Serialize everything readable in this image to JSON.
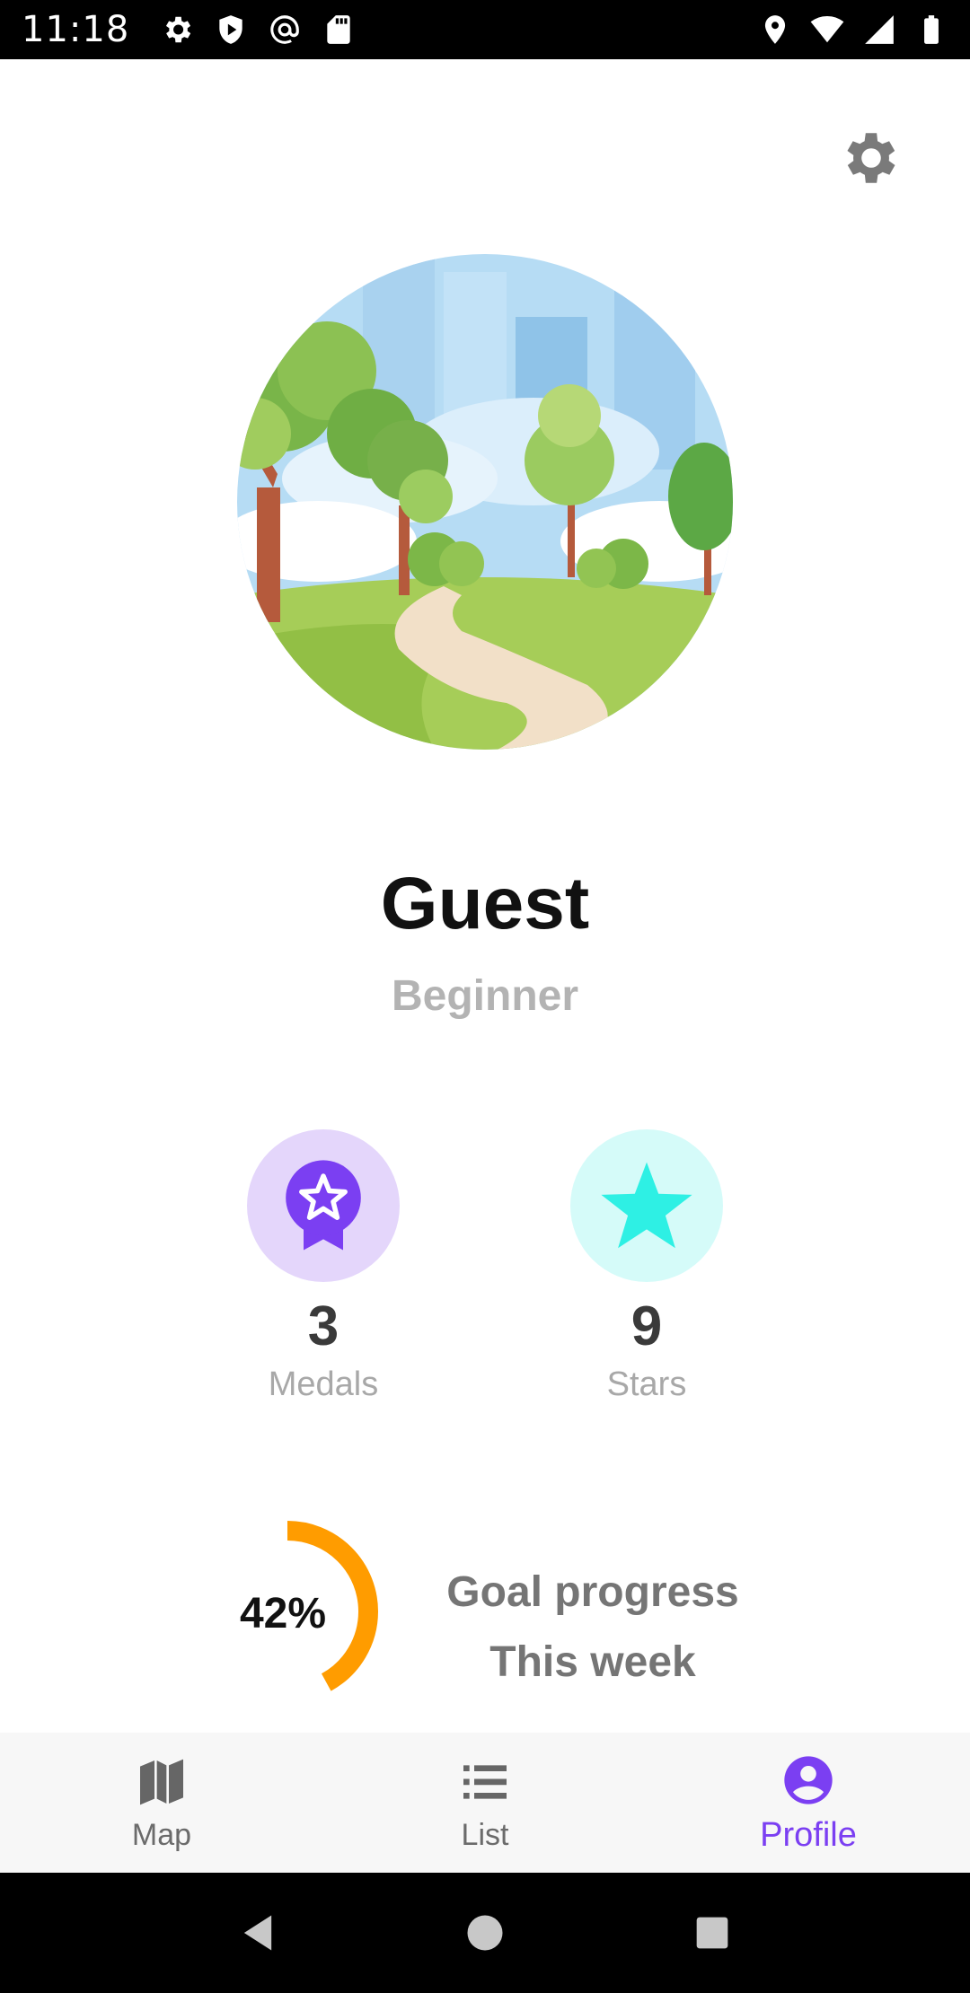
{
  "status_bar": {
    "time": "11:18",
    "left_icons": [
      "gear-icon",
      "shield-icon",
      "at-icon",
      "sd-card-icon"
    ],
    "right_icons": [
      "location-icon",
      "wifi-icon",
      "signal-icon",
      "battery-icon"
    ]
  },
  "settings": {
    "icon": "gear-icon"
  },
  "profile": {
    "name": "Guest",
    "level": "Beginner"
  },
  "stats": {
    "medals": {
      "value": "3",
      "label": "Medals",
      "icon": "medal-icon",
      "color": "#7b3ff2",
      "bg": "#e4d6fb"
    },
    "stars": {
      "value": "9",
      "label": "Stars",
      "icon": "star-icon",
      "color": "#2ef0e4",
      "bg": "#d5fbf9"
    }
  },
  "goal": {
    "percent_label": "42%",
    "fraction": 0.42,
    "title": "Goal progress",
    "subtitle": "This week",
    "color": "#ff9c00"
  },
  "bottom_nav": {
    "items": [
      {
        "label": "Map",
        "icon": "map-icon"
      },
      {
        "label": "List",
        "icon": "list-icon"
      },
      {
        "label": "Profile",
        "icon": "profile-icon",
        "active": true
      }
    ],
    "active_color": "#7b3ff2"
  },
  "system_nav": [
    "back-icon",
    "home-icon",
    "recents-icon"
  ]
}
